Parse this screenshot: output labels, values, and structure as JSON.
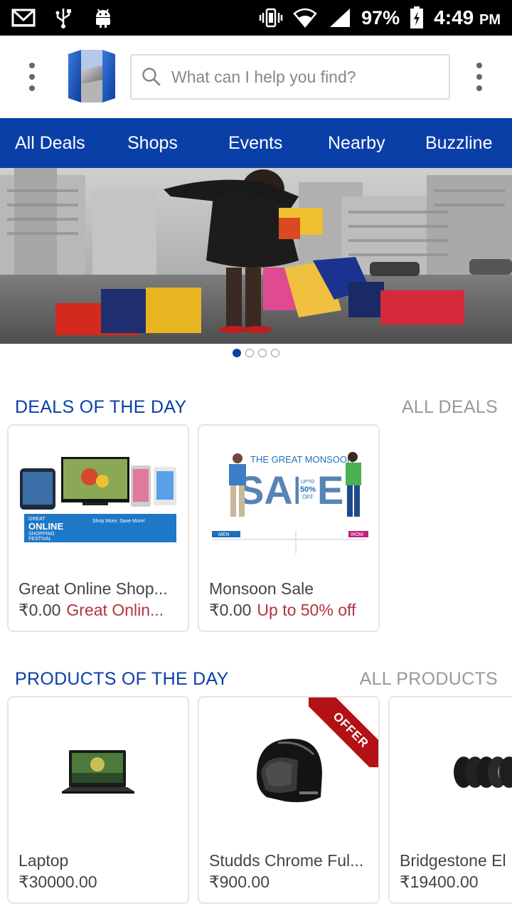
{
  "status_bar": {
    "battery": "97%",
    "time": "4:49",
    "ampm": "PM",
    "icons": [
      "gmail-icon",
      "usb-icon",
      "android-icon",
      "vibrate-icon",
      "wifi-icon",
      "signal-icon",
      "battery-charging-icon"
    ]
  },
  "header": {
    "logo": "h-logo",
    "search_placeholder": "What can I help you find?",
    "search_value": ""
  },
  "nav": {
    "tabs": [
      {
        "label": "All Deals"
      },
      {
        "label": "Shops"
      },
      {
        "label": "Events"
      },
      {
        "label": "Nearby"
      },
      {
        "label": "Buzzline"
      }
    ]
  },
  "banner": {
    "slide_count": 4,
    "active_slide": 1
  },
  "deals": {
    "title": "DEALS OF THE DAY",
    "link": "ALL DEALS",
    "items": [
      {
        "name": "Great Online Shop...",
        "price": "₹0.00",
        "subtitle": "Great Onlin...",
        "image_text_1": "GREAT",
        "image_text_2": "ONLINE",
        "image_text_3": "SHOPPING",
        "image_text_4": "FESTIVAL",
        "image_text_5": "Shop More, Save More!"
      },
      {
        "name": "Monsoon Sale",
        "price": "₹0.00",
        "subtitle": "Up to 50% off",
        "image_text_1": "THE GREAT MONSOON",
        "image_text_2": "SALE",
        "image_text_3": "UPTO",
        "image_text_4": "50%",
        "image_text_5": "OFF",
        "image_text_6": "MEN",
        "image_text_7": "WOM"
      }
    ]
  },
  "products": {
    "title": "PRODUCTS OF THE DAY",
    "link": "ALL PRODUCTS",
    "items": [
      {
        "name": "Laptop",
        "price": "₹30000.00",
        "badge": ""
      },
      {
        "name": "Studds Chrome Ful...",
        "price": "₹900.00",
        "badge": "OFFER"
      },
      {
        "name": "Bridgestone El",
        "price": "₹19400.00",
        "badge": ""
      }
    ]
  },
  "colors": {
    "brand_blue": "#0a3fa8",
    "deal_red": "#b5333d",
    "ribbon_red": "#b21216"
  }
}
